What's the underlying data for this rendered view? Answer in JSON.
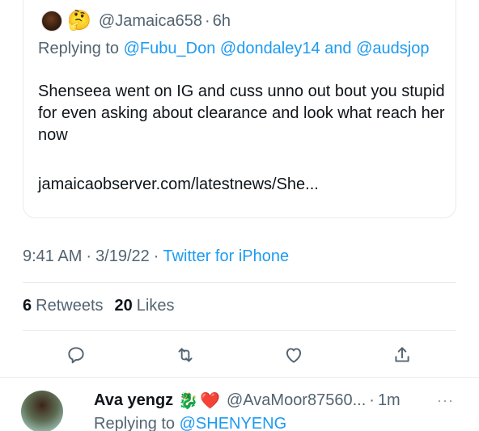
{
  "quoted_tweet": {
    "emoji": "🤔",
    "handle": "@Jamaica658",
    "dot": "·",
    "time": "6h",
    "replying_prefix": "Replying to ",
    "mention_1": "@Fubu_Don",
    "mention_2": "@dondaley14",
    "and_text": " and ",
    "mention_3": "@audsjop",
    "text": "Shenseea went on IG and cuss unno out bout you stupid for even asking about clearance and look what reach her now",
    "link": "jamaicaobserver.com/latestnews/She..."
  },
  "meta": {
    "time": "9:41 AM",
    "date": "3/19/22",
    "sep": "·",
    "source": "Twitter for iPhone"
  },
  "stats": {
    "retweets_count": "6",
    "retweets_label": "Retweets",
    "likes_count": "20",
    "likes_label": "Likes"
  },
  "actions": [
    "reply-icon",
    "retweet-icon",
    "like-icon",
    "share-icon"
  ],
  "reply": {
    "name": "Ava yengz",
    "emoji_1": "🐉",
    "emoji_2": "❤️",
    "handle": "@AvaMoor87560...",
    "dot": "·",
    "time": "1m",
    "more": "···",
    "replying_prefix": "Replying to ",
    "mention": "@SHENYENG"
  },
  "colors": {
    "accent": "#1d9bf0",
    "secondary_text": "#536471",
    "primary_text": "#0f1419",
    "border": "#e6ecf0",
    "heart": "#e0245e"
  }
}
